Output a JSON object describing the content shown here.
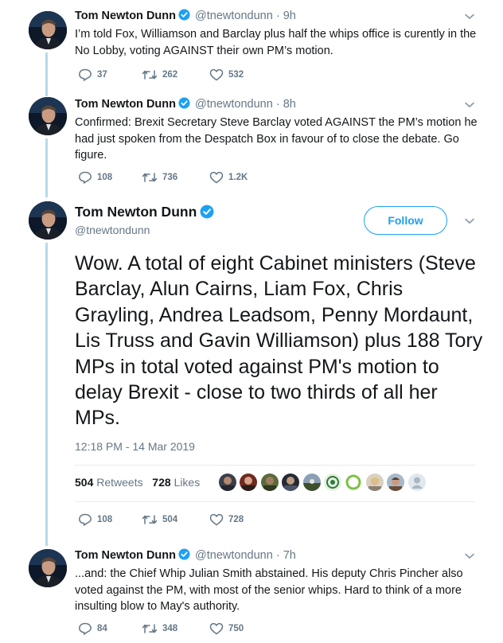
{
  "tweets": [
    {
      "name": "Tom Newton Dunn",
      "handle": "@tnewtondunn",
      "time": "9h",
      "text": "I’m told Fox, Williamson and Barclay plus half the whips office is curently in the No Lobby, voting AGAINST their own PM’s motion.",
      "replies": "37",
      "retweets": "262",
      "likes": "532"
    },
    {
      "name": "Tom Newton Dunn",
      "handle": "@tnewtondunn",
      "time": "8h",
      "text": "Confirmed: Brexit Secretary Steve Barclay voted AGAINST the PM’s motion he had just spoken from the Despatch Box in favour of to close the debate. Go figure.",
      "replies": "108",
      "retweets": "736",
      "likes": "1.2K"
    }
  ],
  "focused": {
    "name": "Tom Newton Dunn",
    "handle": "@tnewtondunn",
    "follow_label": "Follow",
    "text": "Wow. A total of eight Cabinet ministers (Steve Barclay, Alun Cairns, Liam Fox, Chris Grayling, Andrea Leadsom, Penny Mordaunt, Lis Truss and Gavin Williamson) plus 188 Tory MPs in total voted against PM's motion to delay Brexit - close to two thirds of all her MPs.",
    "timestamp": "12:18 PM - 14 Mar 2019",
    "retweet_count": "504",
    "retweet_label": "Retweets",
    "like_count": "728",
    "like_label": "Likes",
    "replies": "108",
    "retweets": "504",
    "likes": "728"
  },
  "reply": {
    "name": "Tom Newton Dunn",
    "handle": "@tnewtondunn",
    "time": "7h",
    "text": "...and: the Chief Whip Julian Smith abstained. His deputy Chris Pincher also voted against the PM, with most of the senior whips. Hard to think of a more insulting blow to May's authority.",
    "replies": "84",
    "retweets": "348",
    "likes": "750"
  },
  "colors": {
    "accent": "#1da1f2",
    "thread": "#b4dbe9",
    "muted": "#657786",
    "text": "#14171a"
  },
  "icons": [
    "verified-badge-icon",
    "chevron-down-icon",
    "reply-icon",
    "retweet-icon",
    "like-icon"
  ]
}
